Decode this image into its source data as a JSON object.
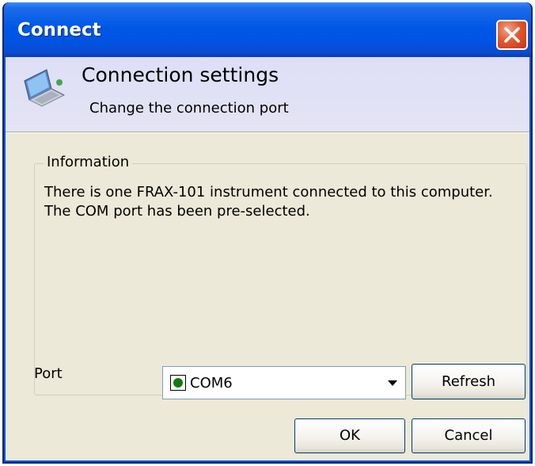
{
  "window": {
    "title": "Connect",
    "close_icon": "close-icon"
  },
  "header": {
    "icon": "connection-computer-icon",
    "title": "Connection settings",
    "subtitle": "Change the connection port"
  },
  "information": {
    "legend": "Information",
    "text": "There is one FRAX-101 instrument connected to this computer. The COM port has been pre-selected."
  },
  "port": {
    "label": "Port",
    "selected_value": "COM6",
    "status_icon": "connected-status-icon",
    "status_color": "#127A12",
    "dropdown_icon": "dropdown-arrow-icon"
  },
  "buttons": {
    "refresh_label": "Refresh",
    "ok_label": "OK",
    "cancel_label": "Cancel"
  },
  "colors": {
    "titlebar": "#0054E3",
    "close_button": "#E3582E",
    "dialog_background": "#ECE9D8",
    "header_background": "#DEDEF7"
  }
}
